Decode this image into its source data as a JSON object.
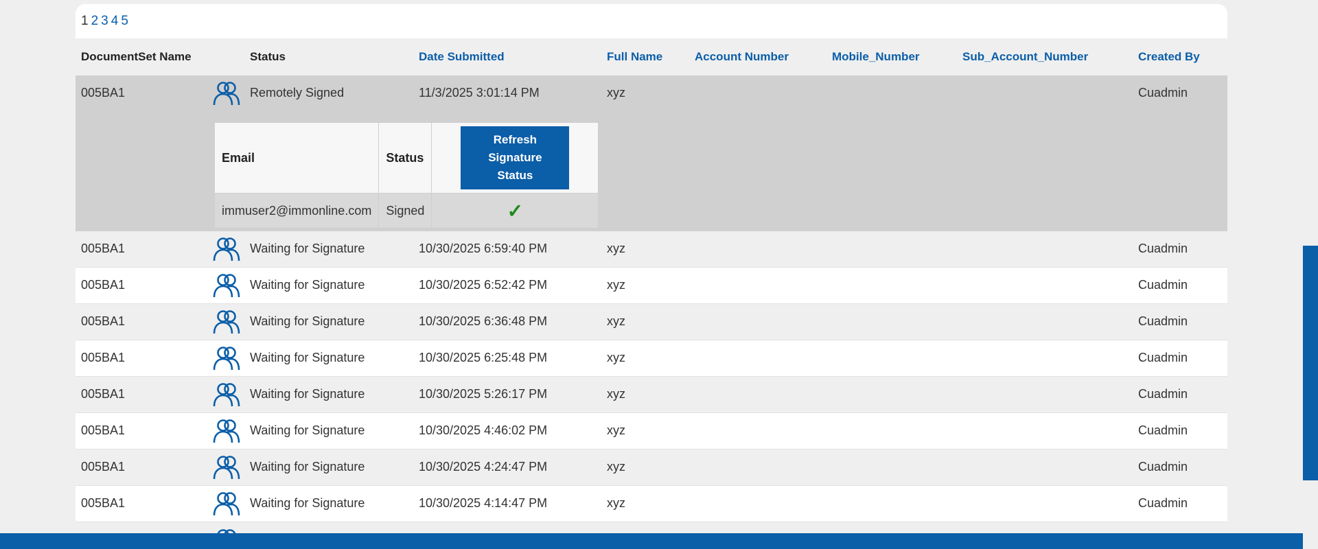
{
  "pagination": {
    "pages": [
      "1",
      "2",
      "3",
      "4",
      "5"
    ],
    "current": "1"
  },
  "columns": {
    "docset": "DocumentSet Name",
    "status": "Status",
    "date": "Date Submitted",
    "fullname": "Full Name",
    "account": "Account Number",
    "mobile": "Mobile_Number",
    "subaccount": "Sub_Account_Number",
    "createdby": "Created By"
  },
  "expanded_row": {
    "docset": "005BA1",
    "icon": "users-icon",
    "status": "Remotely Signed",
    "date": "11/3/2025 3:01:14 PM",
    "fullname": "xyz",
    "createdby": "Cuadmin",
    "subtable": {
      "email_header": "Email",
      "status_header": "Status",
      "refresh_label": "Refresh Signature Status",
      "email": "immuser2@immonline.com",
      "status": "Signed",
      "check": "✓"
    }
  },
  "rows": [
    {
      "docset": "005BA1",
      "status": "Waiting for Signature",
      "date": "10/30/2025 6:59:40 PM",
      "fullname": "xyz",
      "createdby": "Cuadmin"
    },
    {
      "docset": "005BA1",
      "status": "Waiting for Signature",
      "date": "10/30/2025 6:52:42 PM",
      "fullname": "xyz",
      "createdby": "Cuadmin"
    },
    {
      "docset": "005BA1",
      "status": "Waiting for Signature",
      "date": "10/30/2025 6:36:48 PM",
      "fullname": "xyz",
      "createdby": "Cuadmin"
    },
    {
      "docset": "005BA1",
      "status": "Waiting for Signature",
      "date": "10/30/2025 6:25:48 PM",
      "fullname": "xyz",
      "createdby": "Cuadmin"
    },
    {
      "docset": "005BA1",
      "status": "Waiting for Signature",
      "date": "10/30/2025 5:26:17 PM",
      "fullname": "xyz",
      "createdby": "Cuadmin"
    },
    {
      "docset": "005BA1",
      "status": "Waiting for Signature",
      "date": "10/30/2025 4:46:02 PM",
      "fullname": "xyz",
      "createdby": "Cuadmin"
    },
    {
      "docset": "005BA1",
      "status": "Waiting for Signature",
      "date": "10/30/2025 4:24:47 PM",
      "fullname": "xyz",
      "createdby": "Cuadmin"
    },
    {
      "docset": "005BA1",
      "status": "Waiting for Signature",
      "date": "10/30/2025 4:14:47 PM",
      "fullname": "xyz",
      "createdby": "Cuadmin"
    }
  ],
  "colors": {
    "accent": "#0b5ea8",
    "check": "#1b8a1b",
    "expanded_bg": "#d0d0d0"
  }
}
